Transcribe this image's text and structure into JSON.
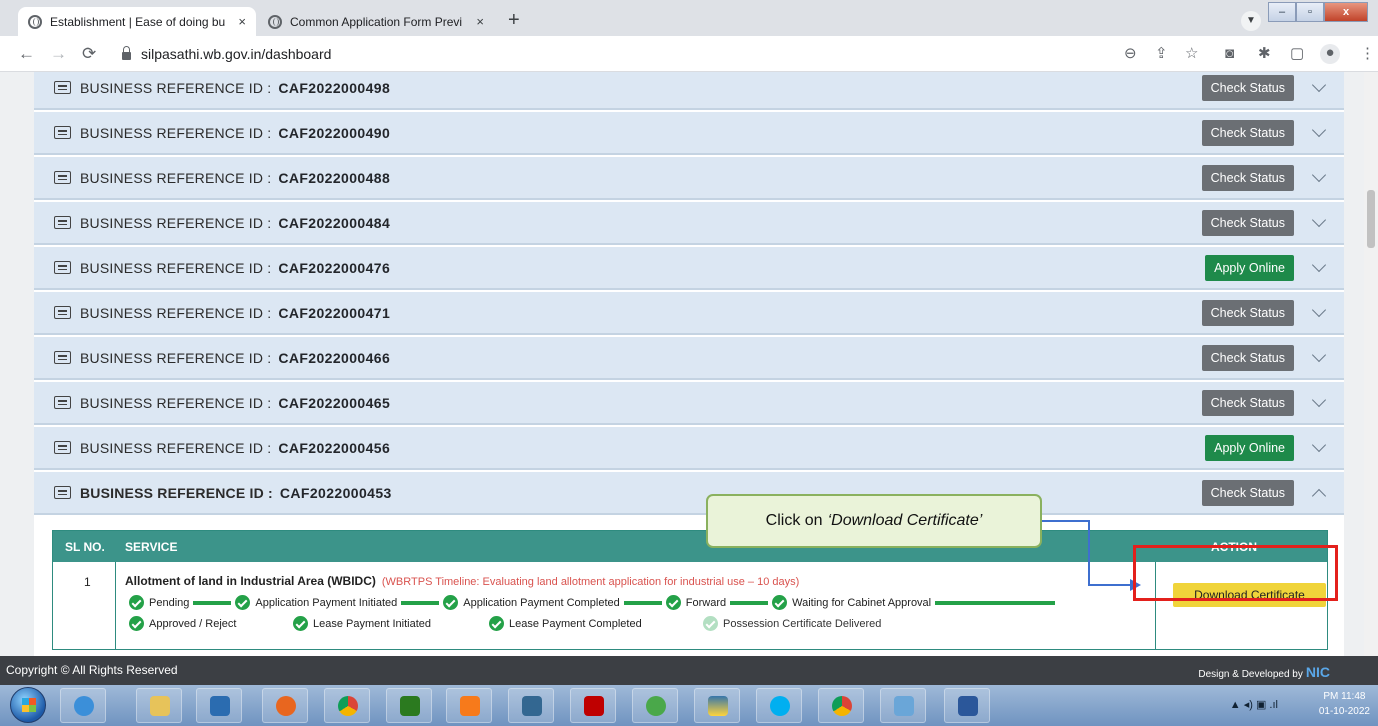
{
  "browser": {
    "tabs": [
      {
        "label": "Establishment | Ease of doing bu",
        "active": true
      },
      {
        "label": "Common Application Form Previ",
        "active": false
      }
    ],
    "tab_close": "×",
    "new_tab": "+",
    "url": "silpasathi.wb.gov.in/dashboard",
    "window_controls": {
      "minimize": "–",
      "maximize": "▫",
      "close": "x"
    }
  },
  "accordion": {
    "label": "BUSINESS REFERENCE ID :",
    "rows": [
      {
        "id": "CAF2022000498",
        "button": "Check Status",
        "kind": "status"
      },
      {
        "id": "CAF2022000490",
        "button": "Check Status",
        "kind": "status"
      },
      {
        "id": "CAF2022000488",
        "button": "Check Status",
        "kind": "status"
      },
      {
        "id": "CAF2022000484",
        "button": "Check Status",
        "kind": "status"
      },
      {
        "id": "CAF2022000476",
        "button": "Apply Online",
        "kind": "apply"
      },
      {
        "id": "CAF2022000471",
        "button": "Check Status",
        "kind": "status"
      },
      {
        "id": "CAF2022000466",
        "button": "Check Status",
        "kind": "status"
      },
      {
        "id": "CAF2022000465",
        "button": "Check Status",
        "kind": "status"
      },
      {
        "id": "CAF2022000456",
        "button": "Apply Online",
        "kind": "apply"
      },
      {
        "id": "CAF2022000453",
        "button": "Check Status",
        "kind": "status",
        "expanded": true
      }
    ]
  },
  "table": {
    "headers": {
      "sl": "SL NO.",
      "service": "SERVICE",
      "action": "ACTION"
    },
    "row": {
      "sl": "1",
      "service": "Allotment of land in Industrial Area (WBIDC)",
      "timeline": "(WBRTPS Timeline: Evaluating land allotment application for industrial use – 10 days)",
      "action": "Download Certificate"
    },
    "steps_line1": [
      "Pending",
      "Application Payment Initiated",
      "Application Payment Completed",
      "Forward",
      "Waiting for Cabinet Approval"
    ],
    "steps_line2": [
      "Approved / Reject",
      "Lease Payment Initiated",
      "Lease Payment Completed",
      "Possession Certificate Delivered"
    ]
  },
  "callout": {
    "prefix": "Click on",
    "emphasis": "‘Download Certificate’"
  },
  "footer": {
    "left": "Copyright © All Rights Reserved",
    "right": "Design & Developed by",
    "brand": "NIC"
  },
  "taskbar": {
    "time": "PM 11:48",
    "date": "01-10-2022"
  },
  "colors": {
    "row_bg": "#dce7f3",
    "status_btn": "#6b6f74",
    "apply_btn": "#1e8a4a",
    "table_head": "#3c948a",
    "download_btn": "#f0d43a",
    "highlight": "#e3201c",
    "arrow": "#3e6fcf"
  }
}
